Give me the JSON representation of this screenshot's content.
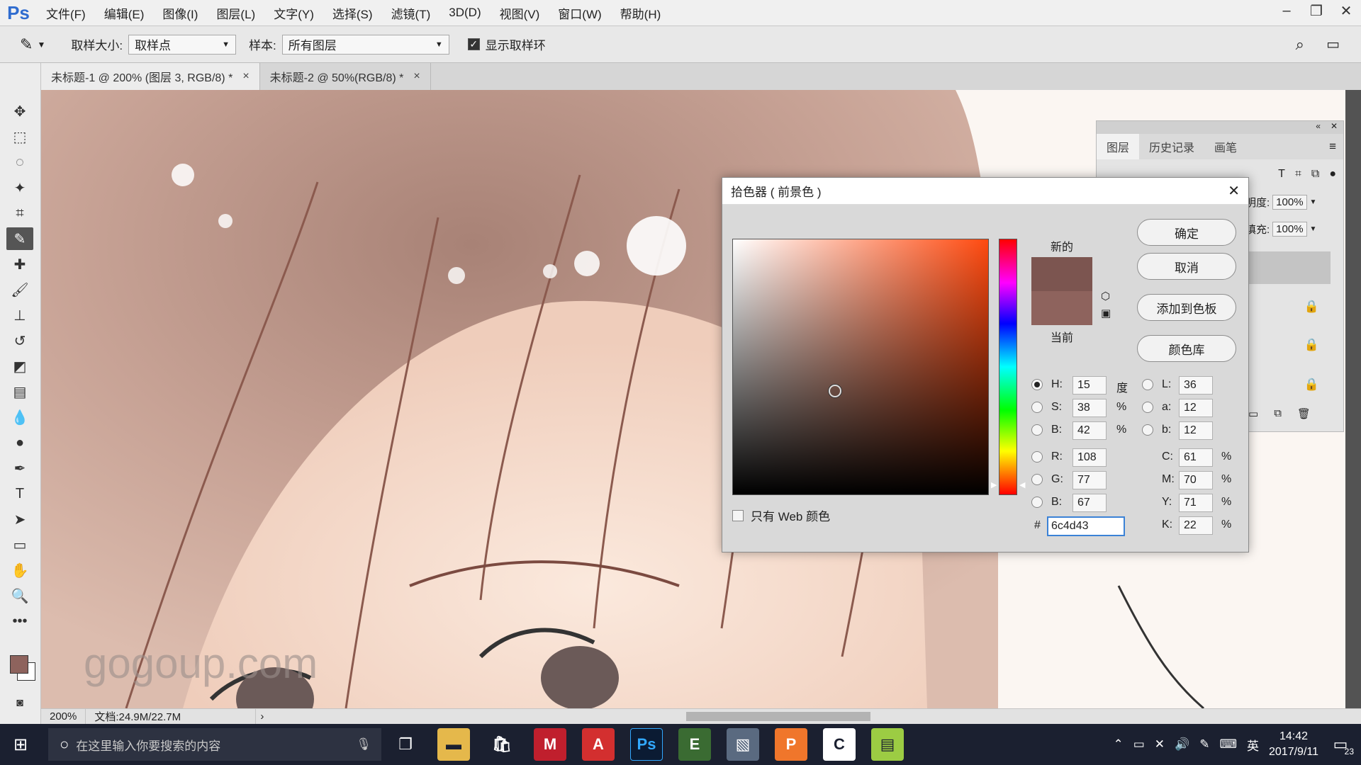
{
  "app": {
    "logo": "Ps",
    "menu": [
      "文件(F)",
      "编辑(E)",
      "图像(I)",
      "图层(L)",
      "文字(Y)",
      "选择(S)",
      "滤镜(T)",
      "3D(D)",
      "视图(V)",
      "窗口(W)",
      "帮助(H)"
    ]
  },
  "options": {
    "sample_size_label": "取样大小:",
    "sample_size_value": "取样点",
    "sample_label": "样本:",
    "sample_value": "所有图层",
    "show_ring_label": "显示取样环"
  },
  "tabs": [
    {
      "label": "未标题-1 @ 200% (图层 3, RGB/8) *",
      "close": "×"
    },
    {
      "label": "未标题-2 @ 50%(RGB/8) *",
      "close": "×"
    }
  ],
  "status": {
    "zoom": "200%",
    "doc": "文档:24.9M/22.7M"
  },
  "layers_panel": {
    "tabs": [
      "图层",
      "历史记录",
      "画笔"
    ],
    "opacity_label": "明度:",
    "opacity_value": "100%",
    "fill_label": "填充:",
    "fill_value": "100%"
  },
  "picker": {
    "title": "拾色器 ( 前景色 )",
    "close": "✕",
    "new_label": "新的",
    "current_label": "当前",
    "buttons": {
      "ok": "确定",
      "cancel": "取消",
      "add_swatch": "添加到色板",
      "libraries": "颜色库"
    },
    "hsb": {
      "h_label": "H:",
      "h": "15",
      "h_unit": "度",
      "s_label": "S:",
      "s": "38",
      "s_unit": "%",
      "b_label": "B:",
      "b": "42",
      "b_unit": "%"
    },
    "lab": {
      "l_label": "L:",
      "l": "36",
      "a_label": "a:",
      "a": "12",
      "b_label": "b:",
      "b": "12"
    },
    "rgb": {
      "r_label": "R:",
      "r": "108",
      "g_label": "G:",
      "g": "77",
      "b_label": "B:",
      "b": "67"
    },
    "cmyk": {
      "c_label": "C:",
      "c": "61",
      "m_label": "M:",
      "m": "70",
      "y_label": "Y:",
      "y": "71",
      "k_label": "K:",
      "k": "22",
      "unit": "%"
    },
    "hex_label": "#",
    "hex": "6c4d43",
    "web_only_label": "只有 Web 颜色",
    "colors": {
      "new": "#7c5550",
      "current": "#8e635d"
    }
  },
  "watermark": "gogoup.com",
  "taskbar": {
    "search_placeholder": "在这里输入你要搜索的内容",
    "ime": "英",
    "time": "14:42",
    "date": "2017/9/11",
    "notifications": "23"
  }
}
